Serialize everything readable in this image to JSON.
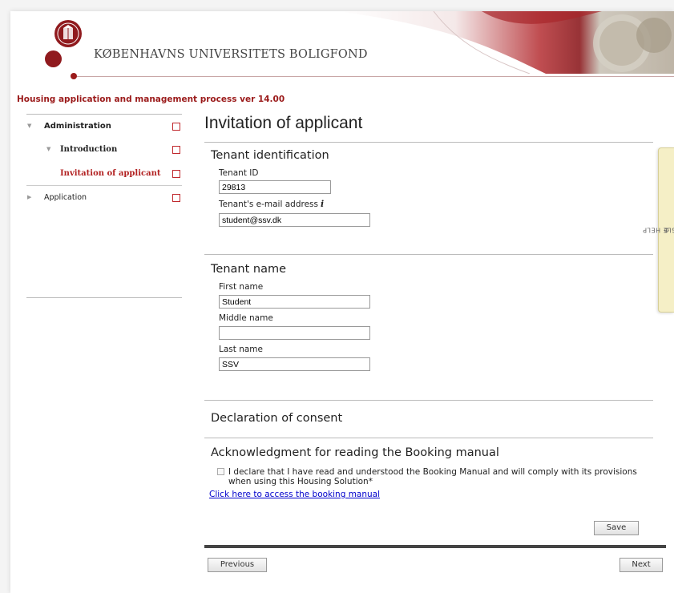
{
  "header": {
    "brand_name": "KØBENHAVNS UNIVERSITETS BOLIGFOND",
    "process_title": "Housing application and management process ver 14.00"
  },
  "sidebar": {
    "items": [
      {
        "label": "Administration"
      },
      {
        "label": "Introduction"
      },
      {
        "label": "Invitation of applicant"
      },
      {
        "label": "Application"
      }
    ]
  },
  "main": {
    "page_title": "Invitation of applicant",
    "tenant_identification": {
      "heading": "Tenant identification",
      "tenant_id_label": "Tenant ID",
      "tenant_id_value": "29813",
      "email_label": "Tenant's e-mail address",
      "email_value": "student@ssv.dk"
    },
    "tenant_name": {
      "heading": "Tenant name",
      "first_name_label": "First name",
      "first_name_value": "Student",
      "middle_name_label": "Middle name",
      "middle_name_value": "",
      "last_name_label": "Last name",
      "last_name_value": "SSV"
    },
    "consent": {
      "heading": "Declaration of consent"
    },
    "acknowledgment": {
      "heading": "Acknowledgment for reading the Booking manual",
      "checkbox_text": "I declare that I have read and understood the Booking Manual and will comply with its provisions when using this Housing Solution",
      "required_mark": "*",
      "link_text": "Click here to access the booking manual"
    }
  },
  "buttons": {
    "save": "Save",
    "previous": "Previous",
    "next": "Next",
    "toggle_help": "TOGGLE HELP"
  },
  "colors": {
    "brand_red": "#901a1e",
    "accent_red": "#9b1b1b",
    "link_blue": "#0000cc",
    "help_tab": "#f5efc6"
  },
  "icons": {
    "info": "info-icon",
    "collapse": "triangle-down-icon",
    "expand": "triangle-right-icon"
  }
}
